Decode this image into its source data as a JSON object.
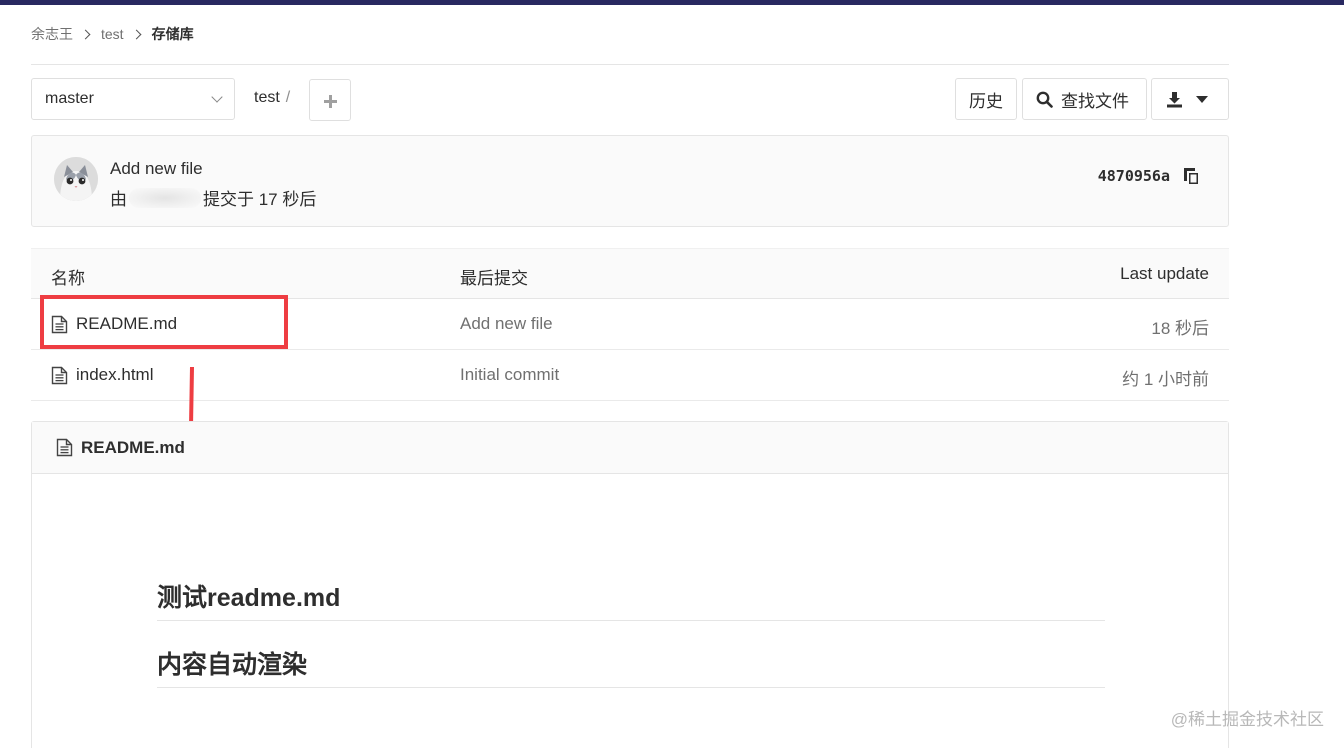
{
  "breadcrumb": {
    "items": [
      "余志王",
      "test",
      "存储库"
    ]
  },
  "toolbar": {
    "branch": "master",
    "path": "test",
    "path_separator": "/",
    "history_label": "历史",
    "find_file_label": "查找文件"
  },
  "commit": {
    "title": "Add new file",
    "by_prefix": "由",
    "committed_suffix": "提交于 17 秒后",
    "sha": "4870956a"
  },
  "file_table": {
    "headers": {
      "name": "名称",
      "last_commit": "最后提交",
      "last_update": "Last update"
    },
    "rows": [
      {
        "name": "README.md",
        "commit": "Add new file",
        "updated": "18 秒后"
      },
      {
        "name": "index.html",
        "commit": "Initial commit",
        "updated": "约 1 小时前"
      }
    ]
  },
  "readme": {
    "filename": "README.md",
    "heading_1": "测试readme.md",
    "heading_2": "内容自动渲染"
  },
  "watermark": "@稀土掘金技术社区",
  "colors": {
    "annotation_red": "#ee3d42",
    "topbar": "#292961"
  }
}
